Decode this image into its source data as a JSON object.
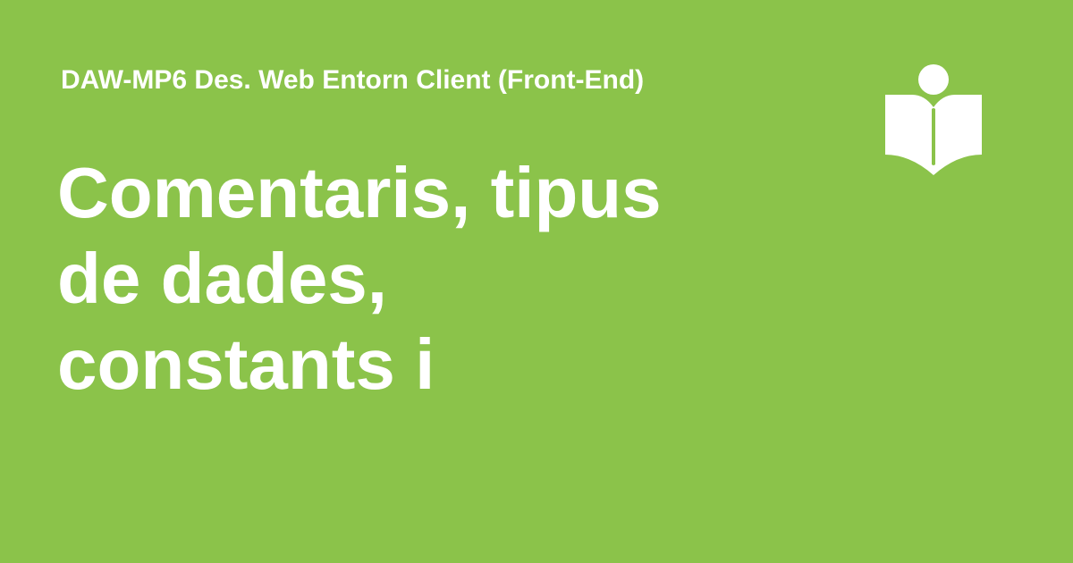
{
  "header": {
    "course_name": "DAW-MP6 Des. Web Entorn Client (Front-End)"
  },
  "main": {
    "title_lines": [
      "Comentaris, tipus",
      "de dades,",
      "constants i"
    ]
  },
  "logo": {
    "icon": "reader-book-icon"
  },
  "colors": {
    "background": "#8bc34a",
    "foreground": "#ffffff"
  }
}
